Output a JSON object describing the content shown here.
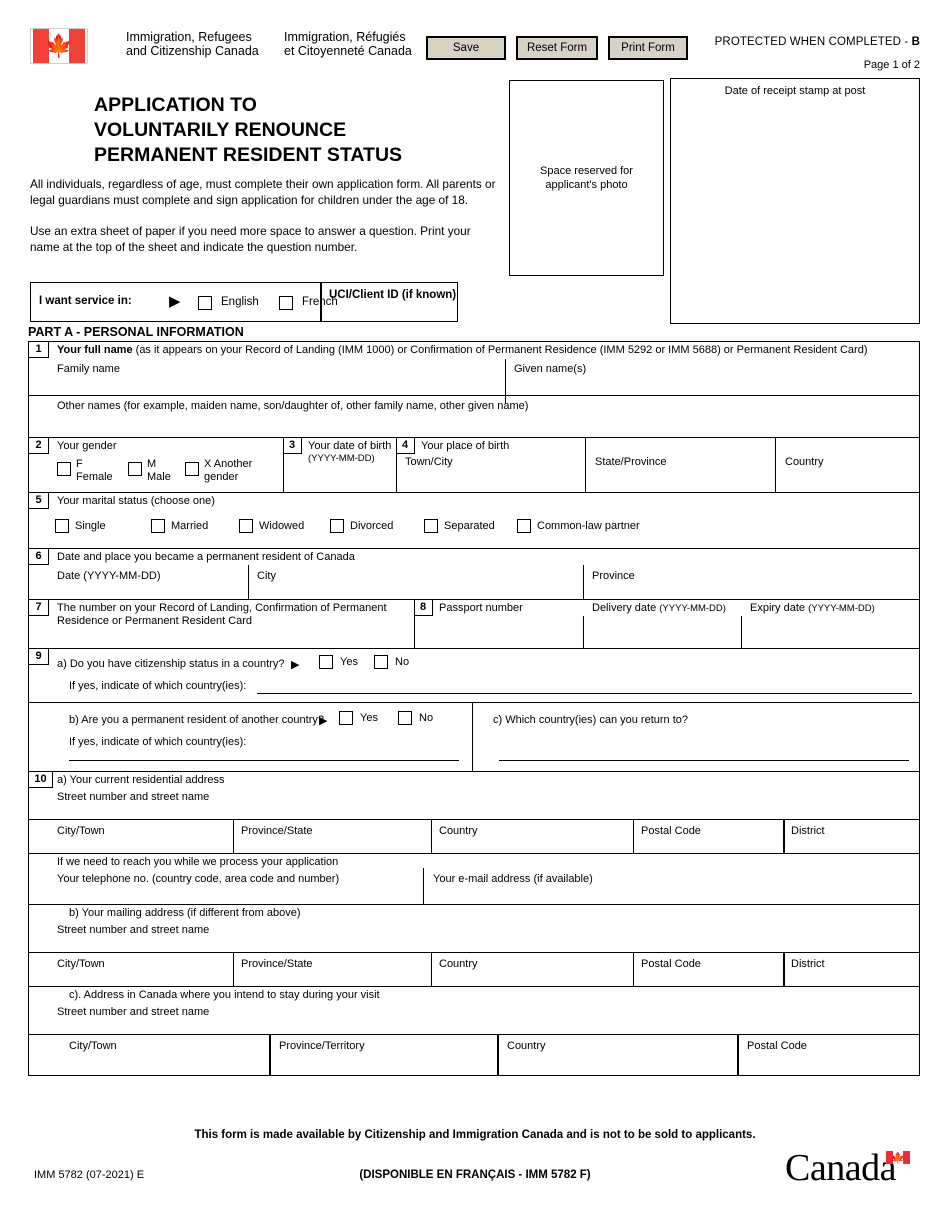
{
  "header": {
    "wordmark_en": "Immigration, Refugees and Citizenship Canada",
    "wordmark_en_l1": "Immigration, Refugees",
    "wordmark_en_l2": "and Citizenship Canada",
    "wordmark_fr_l1": "Immigration, Réfugiés",
    "wordmark_fr_l2": "et Citoyenneté Canada",
    "buttons": {
      "save": "Save",
      "reset": "Reset Form",
      "print": "Print Form"
    },
    "protected_prefix": "PROTECTED WHEN COMPLETED - ",
    "protected_level": "B",
    "page_number": "Page 1 of 2"
  },
  "title": {
    "line1": "APPLICATION TO",
    "line2": "VOLUNTARILY RENOUNCE",
    "line3": "PERMANENT RESIDENT STATUS"
  },
  "intro": {
    "para1": "All individuals, regardless of age, must complete their own application form. All parents or legal guardians must complete and sign application for children under the age of 18.",
    "para2": "Use an extra sheet of paper if you need more space to answer a question. Print your name at the top of the sheet and indicate the question number."
  },
  "photo_box": {
    "line1": "Space reserved for",
    "line2": "applicant's photo"
  },
  "stamp_box": {
    "label": "Date of receipt stamp at post"
  },
  "service_language": {
    "label": "I want service in:",
    "english": "English",
    "french": "French",
    "uci_label": "UCI/Client ID (if known)"
  },
  "part_a": {
    "heading": "PART A - PERSONAL INFORMATION"
  },
  "q1": {
    "num": "1",
    "title_bold": "Your full name",
    "title_rest": " (as it appears on your Record of Landing (IMM 1000) or Confirmation of Permanent Residence (IMM 5292 or IMM 5688) or Permanent Resident Card)",
    "family_name": "Family name",
    "given_names": "Given name(s)",
    "other_names": "Other names (for example, maiden name, son/daughter of, other family name, other given name)"
  },
  "q2": {
    "num": "2",
    "title": "Your gender",
    "options": [
      {
        "code": "F",
        "label": "Female"
      },
      {
        "code": "M",
        "label": "Male"
      },
      {
        "code": "X",
        "label": "Another gender",
        "l1": "X Another",
        "l2": "gender"
      }
    ]
  },
  "q3": {
    "num": "3",
    "title": "Your date of birth",
    "format": "(YYYY-MM-DD)"
  },
  "q4": {
    "num": "4",
    "title": "Your place of birth",
    "town_city": "Town/City",
    "state_province": "State/Province",
    "country": "Country"
  },
  "q5": {
    "num": "5",
    "title": "Your marital status (choose one)",
    "options": [
      "Single",
      "Married",
      "Widowed",
      "Divorced",
      "Separated",
      "Common-law partner"
    ]
  },
  "q6": {
    "num": "6",
    "title": "Date and place you became a permanent resident of Canada",
    "date": "Date (YYYY-MM-DD)",
    "city": "City",
    "province": "Province"
  },
  "q7": {
    "num": "7",
    "title_l1": "The number on your Record of Landing, Confirmation of Permanent",
    "title_l2": "Residence or Permanent Resident Card"
  },
  "q8": {
    "num": "8",
    "passport_number": "Passport number",
    "delivery_date": "Delivery date",
    "delivery_date_fmt": "(YYYY-MM-DD)",
    "expiry_date": "Expiry date",
    "expiry_date_fmt": "(YYYY-MM-DD)"
  },
  "q9": {
    "num": "9",
    "a_text": "a)  Do you have citizenship status in a country?",
    "a_yes": "Yes",
    "a_no": "No",
    "a_if_yes": "If yes, indicate of which country(ies):",
    "b_text": "b)  Are you a permanent resident of another country?",
    "b_yes": "Yes",
    "b_no": "No",
    "b_if_yes": "If yes, indicate of which country(ies):",
    "c_text": "c)  Which country(ies) can you return to?"
  },
  "q10": {
    "num": "10",
    "a_title": "a) Your current residential address",
    "a_street": "Street number and street name",
    "addr_headers_a": [
      "City/Town",
      "Province/State",
      "Country",
      "Postal Code",
      "District"
    ],
    "contact_title": "If we need to reach you while we process your application",
    "contact_tel": "Your telephone no. (country code, area code and number)",
    "contact_email": "Your e-mail address (if available)",
    "b_title": "b) Your mailing address (if different from above)",
    "b_street": "Street number and street name",
    "addr_headers_b": [
      "City/Town",
      "Province/State",
      "Country",
      "Postal Code",
      "District"
    ],
    "c_title": "c). Address in Canada where you intend to stay during your visit",
    "c_street": "Street number and street name",
    "addr_headers_c": [
      "City/Town",
      "Province/Territory",
      "Country",
      "Postal Code"
    ]
  },
  "footer": {
    "note": "This form is made available by Citizenship and Immigration Canada and is not to be sold to applicants.",
    "imm_code": "IMM 5782 (07-2021) E",
    "disponible": "(DISPONIBLE EN FRANÇAIS - IMM 5782 F)",
    "wordmark": "Canada"
  },
  "colors": {
    "flag_red": "#ef4136",
    "button_face": "#d6d2c4",
    "wordmark_red": "#ea2d36"
  }
}
